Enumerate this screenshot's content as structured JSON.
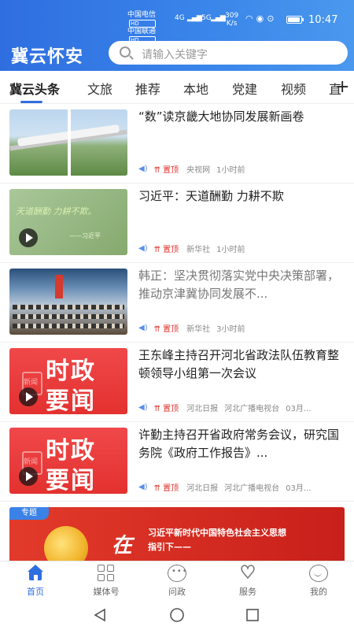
{
  "status_bar": {
    "carrier1": "中国电信",
    "carrier2": "中国联通",
    "hd": "HD",
    "net1": "4G",
    "net2": "5G",
    "speed_value": "309",
    "speed_unit": "K/s",
    "time": "10:47",
    "battery_level": 0.85
  },
  "header": {
    "brand": "冀云怀安",
    "search_placeholder": "请输入关键字"
  },
  "tabs": [
    {
      "label": "冀云头条"
    },
    {
      "label": "文旅"
    },
    {
      "label": "推荐"
    },
    {
      "label": "本地"
    },
    {
      "label": "党建"
    },
    {
      "label": "视频"
    },
    {
      "label": "直"
    }
  ],
  "add_tab_label": "+",
  "news": [
    {
      "title": "“数”读京畿大地协同发展新画卷",
      "pin": "置顶",
      "source": "央视网",
      "time": "1小时前",
      "video": false
    },
    {
      "title": "习近平：天道酬勤 力耕不欺",
      "pin": "置顶",
      "source": "新华社",
      "time": "1小时前",
      "video": true,
      "thumb_text": "天道酬勤 力耕不欺。",
      "thumb_sign": "——习近平"
    },
    {
      "title": "韩正：坚决贯彻落实党中央决策部署，推动京津冀协同发展不...",
      "pin": "置顶",
      "source": "新华社",
      "time": "3小时前",
      "video": false
    },
    {
      "title": "王东峰主持召开河北省政法队伍教育整顿领导小组第一次会议",
      "pin": "置顶",
      "source": "河北日报",
      "source2": "河北广播电视台",
      "time": "03月...",
      "video": true,
      "thumb_line1": "时政",
      "thumb_line2": "要闻",
      "thumb_ghost": "新闻"
    },
    {
      "title": "许勤主持召开省政府常务会议，研究国务院《政府工作报告》...",
      "pin": "置顶",
      "source": "河北日报",
      "source2": "河北广播电视台",
      "time": "03月...",
      "video": true,
      "thumb_line1": "时政",
      "thumb_line2": "要闻",
      "thumb_ghost": "新闻"
    }
  ],
  "banner": {
    "tag": "专题",
    "big_char": "在",
    "line1": "习近平新时代中国特色社会主义思想",
    "line2": "指引下——"
  },
  "bottom_nav": [
    {
      "label": "首页",
      "icon": "home-icon",
      "active": true
    },
    {
      "label": "媒体号",
      "icon": "grid-icon"
    },
    {
      "label": "问政",
      "icon": "chat-bubble-icon"
    },
    {
      "label": "服务",
      "icon": "heart-icon"
    },
    {
      "label": "我的",
      "icon": "profile-face-icon"
    }
  ],
  "colors": {
    "brand_blue": "#2f6ee0",
    "pin_red": "#e0322a",
    "news_red": "#e3312f"
  }
}
